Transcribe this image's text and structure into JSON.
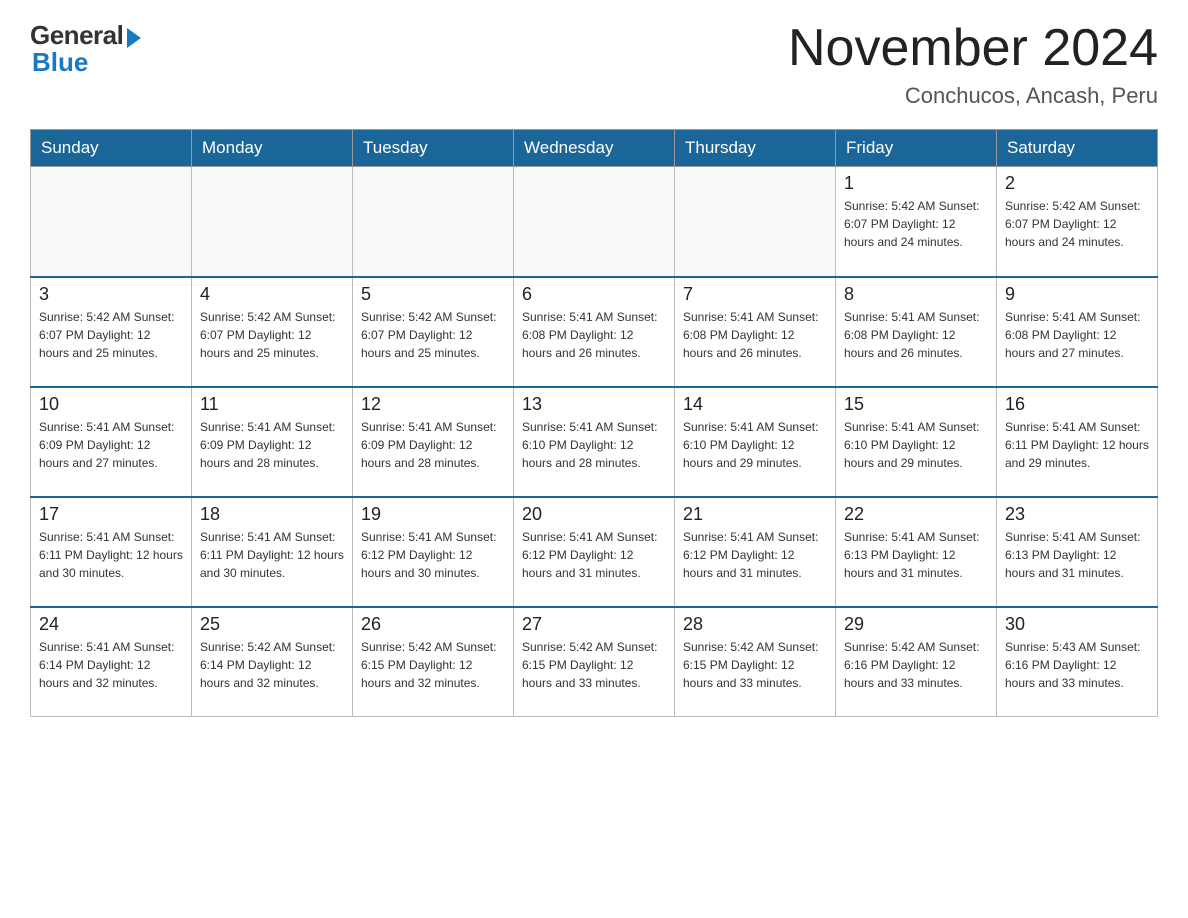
{
  "logo": {
    "general": "General",
    "blue": "Blue"
  },
  "title": "November 2024",
  "subtitle": "Conchucos, Ancash, Peru",
  "headers": [
    "Sunday",
    "Monday",
    "Tuesday",
    "Wednesday",
    "Thursday",
    "Friday",
    "Saturday"
  ],
  "weeks": [
    [
      {
        "day": "",
        "info": ""
      },
      {
        "day": "",
        "info": ""
      },
      {
        "day": "",
        "info": ""
      },
      {
        "day": "",
        "info": ""
      },
      {
        "day": "",
        "info": ""
      },
      {
        "day": "1",
        "info": "Sunrise: 5:42 AM\nSunset: 6:07 PM\nDaylight: 12 hours\nand 24 minutes."
      },
      {
        "day": "2",
        "info": "Sunrise: 5:42 AM\nSunset: 6:07 PM\nDaylight: 12 hours\nand 24 minutes."
      }
    ],
    [
      {
        "day": "3",
        "info": "Sunrise: 5:42 AM\nSunset: 6:07 PM\nDaylight: 12 hours\nand 25 minutes."
      },
      {
        "day": "4",
        "info": "Sunrise: 5:42 AM\nSunset: 6:07 PM\nDaylight: 12 hours\nand 25 minutes."
      },
      {
        "day": "5",
        "info": "Sunrise: 5:42 AM\nSunset: 6:07 PM\nDaylight: 12 hours\nand 25 minutes."
      },
      {
        "day": "6",
        "info": "Sunrise: 5:41 AM\nSunset: 6:08 PM\nDaylight: 12 hours\nand 26 minutes."
      },
      {
        "day": "7",
        "info": "Sunrise: 5:41 AM\nSunset: 6:08 PM\nDaylight: 12 hours\nand 26 minutes."
      },
      {
        "day": "8",
        "info": "Sunrise: 5:41 AM\nSunset: 6:08 PM\nDaylight: 12 hours\nand 26 minutes."
      },
      {
        "day": "9",
        "info": "Sunrise: 5:41 AM\nSunset: 6:08 PM\nDaylight: 12 hours\nand 27 minutes."
      }
    ],
    [
      {
        "day": "10",
        "info": "Sunrise: 5:41 AM\nSunset: 6:09 PM\nDaylight: 12 hours\nand 27 minutes."
      },
      {
        "day": "11",
        "info": "Sunrise: 5:41 AM\nSunset: 6:09 PM\nDaylight: 12 hours\nand 28 minutes."
      },
      {
        "day": "12",
        "info": "Sunrise: 5:41 AM\nSunset: 6:09 PM\nDaylight: 12 hours\nand 28 minutes."
      },
      {
        "day": "13",
        "info": "Sunrise: 5:41 AM\nSunset: 6:10 PM\nDaylight: 12 hours\nand 28 minutes."
      },
      {
        "day": "14",
        "info": "Sunrise: 5:41 AM\nSunset: 6:10 PM\nDaylight: 12 hours\nand 29 minutes."
      },
      {
        "day": "15",
        "info": "Sunrise: 5:41 AM\nSunset: 6:10 PM\nDaylight: 12 hours\nand 29 minutes."
      },
      {
        "day": "16",
        "info": "Sunrise: 5:41 AM\nSunset: 6:11 PM\nDaylight: 12 hours\nand 29 minutes."
      }
    ],
    [
      {
        "day": "17",
        "info": "Sunrise: 5:41 AM\nSunset: 6:11 PM\nDaylight: 12 hours\nand 30 minutes."
      },
      {
        "day": "18",
        "info": "Sunrise: 5:41 AM\nSunset: 6:11 PM\nDaylight: 12 hours\nand 30 minutes."
      },
      {
        "day": "19",
        "info": "Sunrise: 5:41 AM\nSunset: 6:12 PM\nDaylight: 12 hours\nand 30 minutes."
      },
      {
        "day": "20",
        "info": "Sunrise: 5:41 AM\nSunset: 6:12 PM\nDaylight: 12 hours\nand 31 minutes."
      },
      {
        "day": "21",
        "info": "Sunrise: 5:41 AM\nSunset: 6:12 PM\nDaylight: 12 hours\nand 31 minutes."
      },
      {
        "day": "22",
        "info": "Sunrise: 5:41 AM\nSunset: 6:13 PM\nDaylight: 12 hours\nand 31 minutes."
      },
      {
        "day": "23",
        "info": "Sunrise: 5:41 AM\nSunset: 6:13 PM\nDaylight: 12 hours\nand 31 minutes."
      }
    ],
    [
      {
        "day": "24",
        "info": "Sunrise: 5:41 AM\nSunset: 6:14 PM\nDaylight: 12 hours\nand 32 minutes."
      },
      {
        "day": "25",
        "info": "Sunrise: 5:42 AM\nSunset: 6:14 PM\nDaylight: 12 hours\nand 32 minutes."
      },
      {
        "day": "26",
        "info": "Sunrise: 5:42 AM\nSunset: 6:15 PM\nDaylight: 12 hours\nand 32 minutes."
      },
      {
        "day": "27",
        "info": "Sunrise: 5:42 AM\nSunset: 6:15 PM\nDaylight: 12 hours\nand 33 minutes."
      },
      {
        "day": "28",
        "info": "Sunrise: 5:42 AM\nSunset: 6:15 PM\nDaylight: 12 hours\nand 33 minutes."
      },
      {
        "day": "29",
        "info": "Sunrise: 5:42 AM\nSunset: 6:16 PM\nDaylight: 12 hours\nand 33 minutes."
      },
      {
        "day": "30",
        "info": "Sunrise: 5:43 AM\nSunset: 6:16 PM\nDaylight: 12 hours\nand 33 minutes."
      }
    ]
  ]
}
